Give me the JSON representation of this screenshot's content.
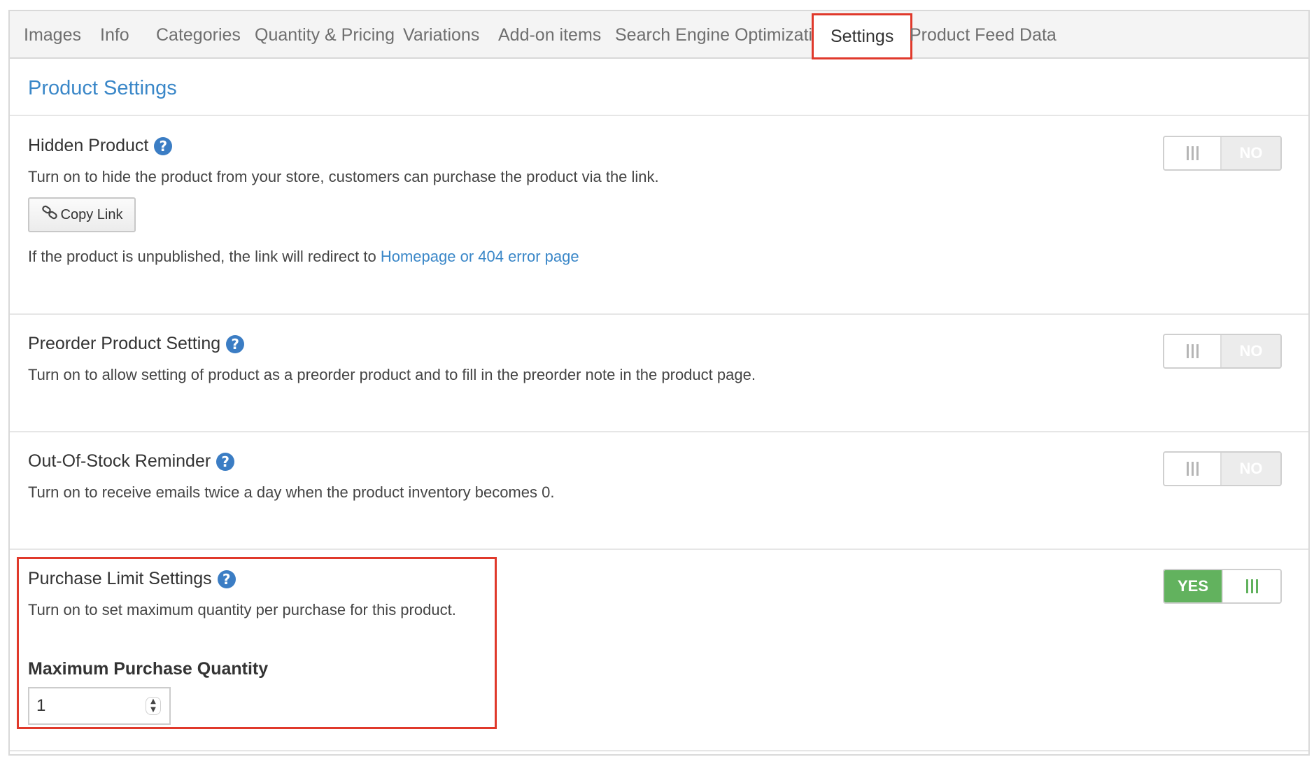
{
  "tabs": [
    {
      "label": "Images"
    },
    {
      "label": "Info"
    },
    {
      "label": "Categories"
    },
    {
      "label": "Quantity & Pricing"
    },
    {
      "label": "Variations"
    },
    {
      "label": "Add-on items"
    },
    {
      "label": "Search Engine Optimization"
    },
    {
      "label": "Settings",
      "active": true
    },
    {
      "label": "Product Feed Data"
    }
  ],
  "page_title": "Product Settings",
  "settings": {
    "hidden_product": {
      "title": "Hidden Product",
      "description": "Turn on to hide the product from your store, customers can purchase the product via the link.",
      "copy_link_label": "Copy Link",
      "redirect_note": "If the product is unpublished, the link will redirect to",
      "redirect_link": "Homepage or 404 error page",
      "toggle_value": "NO"
    },
    "preorder": {
      "title": "Preorder Product Setting",
      "description": "Turn on to allow setting of product as a preorder product and to fill in the preorder note in the product page.",
      "toggle_value": "NO"
    },
    "out_of_stock": {
      "title": "Out-Of-Stock Reminder",
      "description": "Turn on to receive emails twice a day when the product inventory becomes 0.",
      "toggle_value": "NO"
    },
    "purchase_limit": {
      "title": "Purchase Limit Settings",
      "description": "Turn on to set maximum quantity per purchase for this product.",
      "toggle_value": "YES",
      "max_label": "Maximum Purchase Quantity",
      "max_value": "1"
    }
  },
  "help_glyph": "?",
  "colors": {
    "accent_blue": "#3a87c8",
    "toggle_on_green": "#62b25e",
    "highlight_red": "#e0392b"
  },
  "icons": {
    "help": "question-circle-icon",
    "copy": "link-icon",
    "toggle_handle": "grip-bars-icon",
    "stepper": "spin-arrows-icon"
  }
}
